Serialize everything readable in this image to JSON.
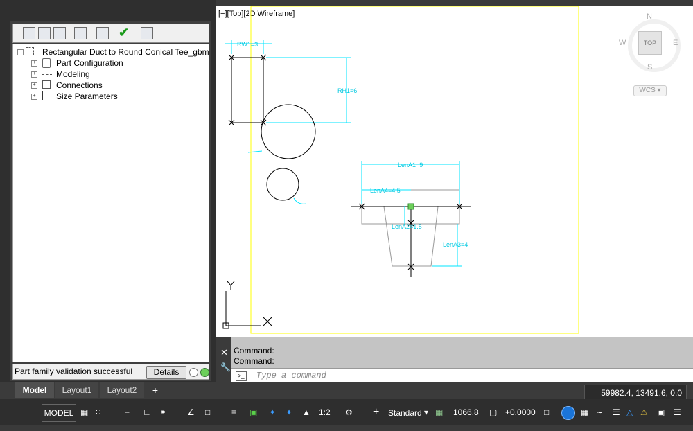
{
  "tree": {
    "root_label": "Rectangular Duct to Round Conical Tee_gbm",
    "items": [
      {
        "label": "Part Configuration"
      },
      {
        "label": "Modeling"
      },
      {
        "label": "Connections"
      },
      {
        "label": "Size Parameters"
      }
    ]
  },
  "status": {
    "message": "Part family validation successful",
    "details_label": "Details"
  },
  "viewport": {
    "label": "[−][Top][2D Wireframe]",
    "dims": {
      "rw1": "RW1=3",
      "rh1": "RH1=6",
      "lena1": "LenA1=9",
      "lena4": "LenA4=4.5",
      "lena2": "LenA2=1.5",
      "lena3": "LenA3=4"
    },
    "axis_y": "Y",
    "axis_x": "X"
  },
  "viewcube": {
    "north": "N",
    "south": "S",
    "east": "E",
    "west": "W",
    "face": "TOP",
    "wcs": "WCS"
  },
  "command": {
    "history": [
      "Command:",
      "Command:"
    ],
    "placeholder": "Type a command"
  },
  "layout_tabs": {
    "model": "Model",
    "layout1": "Layout1",
    "layout2": "Layout2",
    "add": "+"
  },
  "coordinates": "59982.4, 13491.6, 0.0",
  "statusbar": {
    "model_label": "MODEL",
    "scale": "1:2",
    "style": "Standard",
    "value1": "1066.8",
    "value2": "+0.0000"
  },
  "colors": {
    "cyan": "#00e5ff",
    "yellow": "#ffff00",
    "accent_blue": "#1a74d8"
  }
}
